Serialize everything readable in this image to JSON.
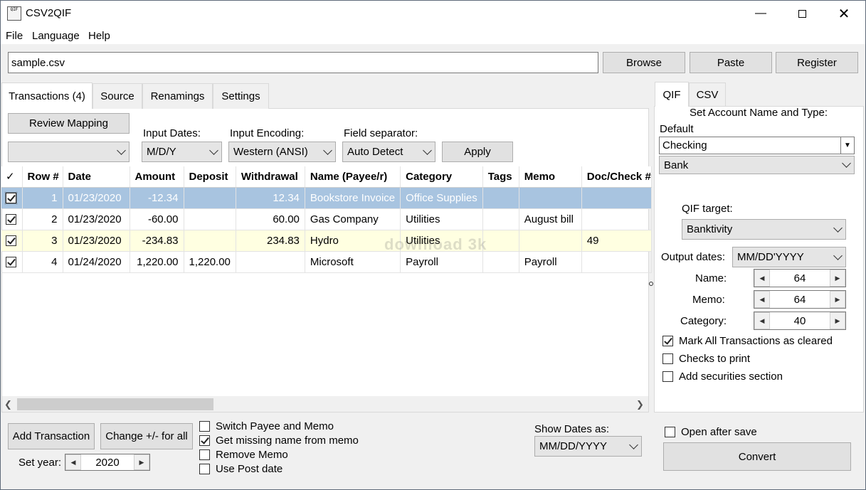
{
  "window": {
    "title": "CSV2QIF",
    "icon_text": "QIF"
  },
  "menu": [
    "File",
    "Language",
    "Help"
  ],
  "file_input": {
    "value": "sample.csv"
  },
  "top_buttons": {
    "browse": "Browse",
    "paste": "Paste",
    "register": "Register"
  },
  "left_tabs": [
    "Transactions (4)",
    "Source",
    "Renamings",
    "Settings"
  ],
  "mapping": {
    "review_button": "Review Mapping",
    "input_dates_label": "Input Dates:",
    "input_dates_value": "M/D/Y",
    "input_encoding_label": "Input Encoding:",
    "input_encoding_value": "Western (ANSI)",
    "field_separator_label": "Field separator:",
    "field_separator_value": "Auto Detect",
    "apply_button": "Apply"
  },
  "table": {
    "columns": [
      "✓",
      "Row #",
      "Date",
      "Amount",
      "Deposit",
      "Withdrawal",
      "Name (Payee/r)",
      "Category",
      "Tags",
      "Memo",
      "Doc/Check #"
    ],
    "rows": [
      {
        "checked": true,
        "row": "1",
        "date": "01/23/2020",
        "amount": "-12.34",
        "deposit": "",
        "withdrawal": "12.34",
        "name": "Bookstore Invoice",
        "category": "Office Supplies",
        "tags": "",
        "memo": "",
        "doc": ""
      },
      {
        "checked": true,
        "row": "2",
        "date": "01/23/2020",
        "amount": "-60.00",
        "deposit": "",
        "withdrawal": "60.00",
        "name": "Gas Company",
        "category": "Utilities",
        "tags": "",
        "memo": "August bill",
        "doc": ""
      },
      {
        "checked": true,
        "row": "3",
        "date": "01/23/2020",
        "amount": "-234.83",
        "deposit": "",
        "withdrawal": "234.83",
        "name": "Hydro",
        "category": "Utilities",
        "tags": "",
        "memo": "",
        "doc": "49"
      },
      {
        "checked": true,
        "row": "4",
        "date": "01/24/2020",
        "amount": "1,220.00",
        "deposit": "1,220.00",
        "withdrawal": "",
        "name": "Microsoft",
        "category": "Payroll",
        "tags": "",
        "memo": "Payroll",
        "doc": ""
      }
    ]
  },
  "watermark": "download 3k",
  "bottom": {
    "add_transaction": "Add Transaction",
    "change_sign": "Change +/- for all",
    "set_year_label": "Set year:",
    "set_year_value": "2020",
    "options": [
      {
        "label": "Switch Payee and Memo",
        "checked": false
      },
      {
        "label": "Get missing name from memo",
        "checked": true
      },
      {
        "label": "Remove Memo",
        "checked": false
      },
      {
        "label": "Use Post date",
        "checked": false
      }
    ],
    "show_dates_label": "Show Dates as:",
    "show_dates_value": "MM/DD/YYYY"
  },
  "right_tabs": [
    "QIF",
    "CSV"
  ],
  "qif": {
    "account_heading": "Set Account Name and Type:",
    "default_label": "Default",
    "account_name": "Checking",
    "account_type": "Bank",
    "qif_target_label": "QIF target:",
    "qif_target_value": "Banktivity",
    "output_dates_label": "Output dates:",
    "output_dates_value": "MM/DD'YYYY",
    "name_label": "Name:",
    "name_value": "64",
    "memo_label": "Memo:",
    "memo_value": "64",
    "category_label": "Category:",
    "category_value": "40",
    "checks": [
      {
        "label": "Mark All Transactions as cleared",
        "checked": true
      },
      {
        "label": "Checks to print",
        "checked": false
      },
      {
        "label": "Add securities section",
        "checked": false
      }
    ]
  },
  "output": {
    "open_after_save": "Open after save",
    "open_after_save_checked": false,
    "convert_button": "Convert"
  }
}
